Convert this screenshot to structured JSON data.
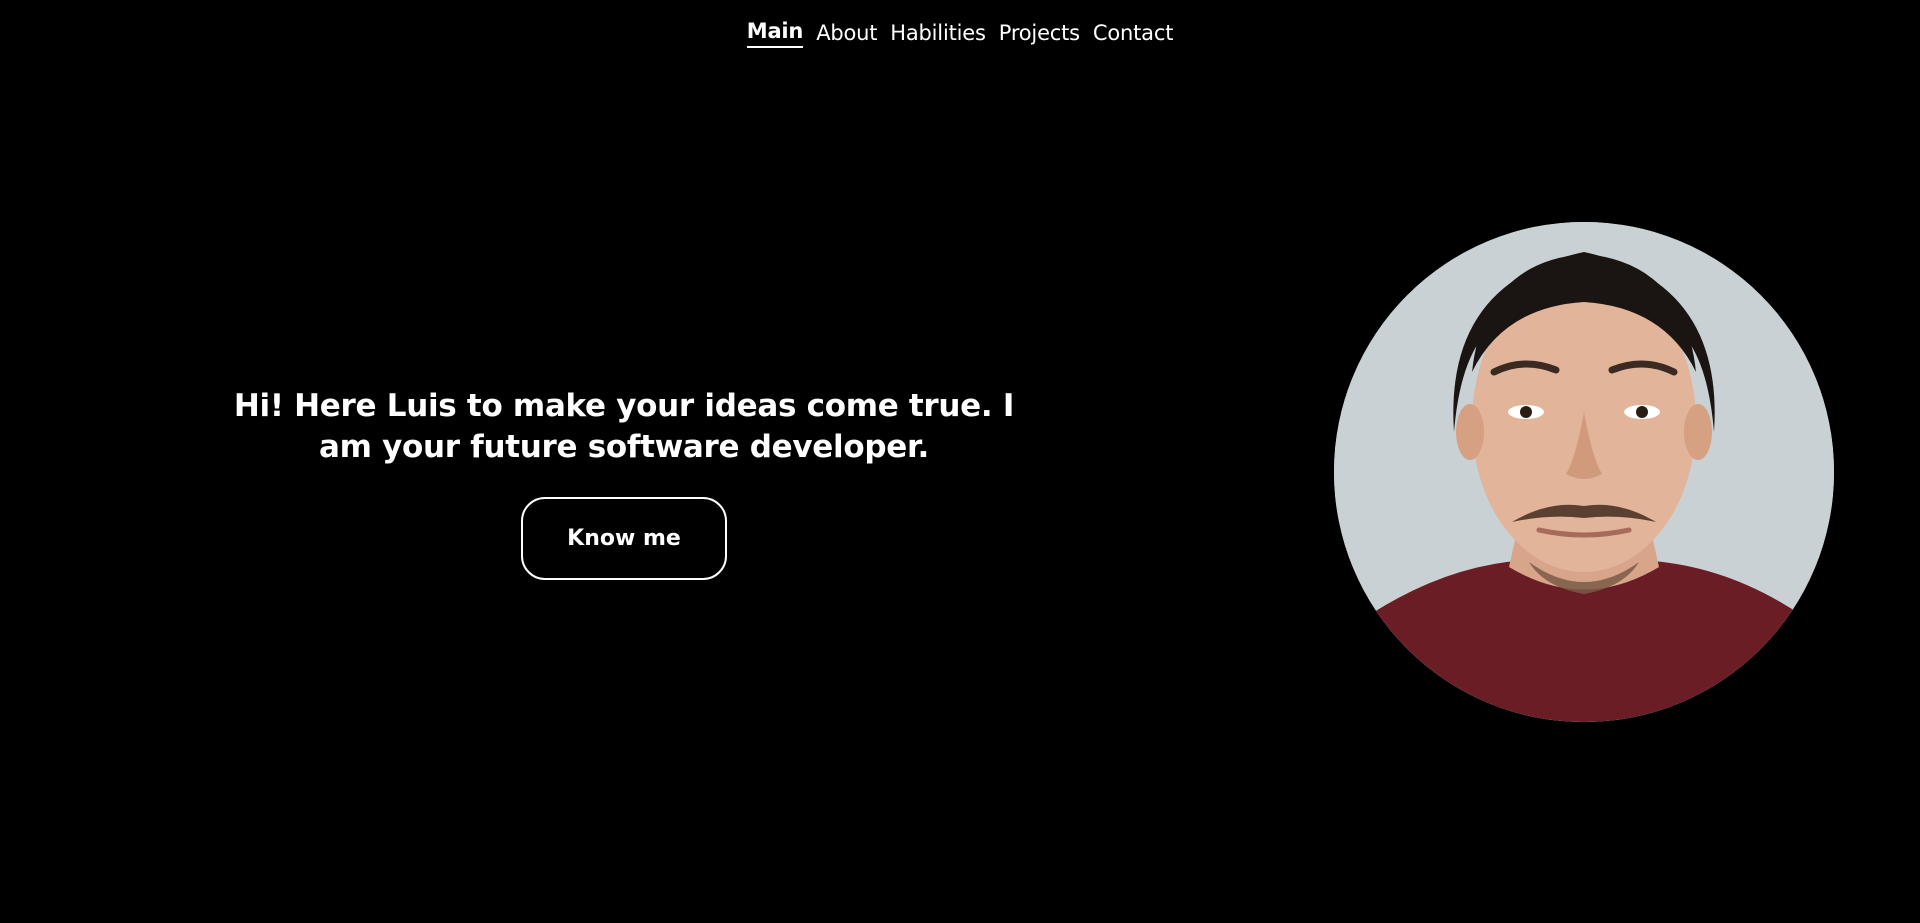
{
  "nav": {
    "items": [
      {
        "label": "Main",
        "active": true
      },
      {
        "label": "About",
        "active": false
      },
      {
        "label": "Habilities",
        "active": false
      },
      {
        "label": "Projects",
        "active": false
      },
      {
        "label": "Contact",
        "active": false
      }
    ]
  },
  "hero": {
    "title": "Hi! Here Luis to make your ideas come true. I am your future software developer.",
    "cta_label": "Know me"
  },
  "colors": {
    "background": "#000000",
    "text": "#ffffff",
    "shirt": "#6b1d26",
    "wall": "#c9d1d4"
  }
}
